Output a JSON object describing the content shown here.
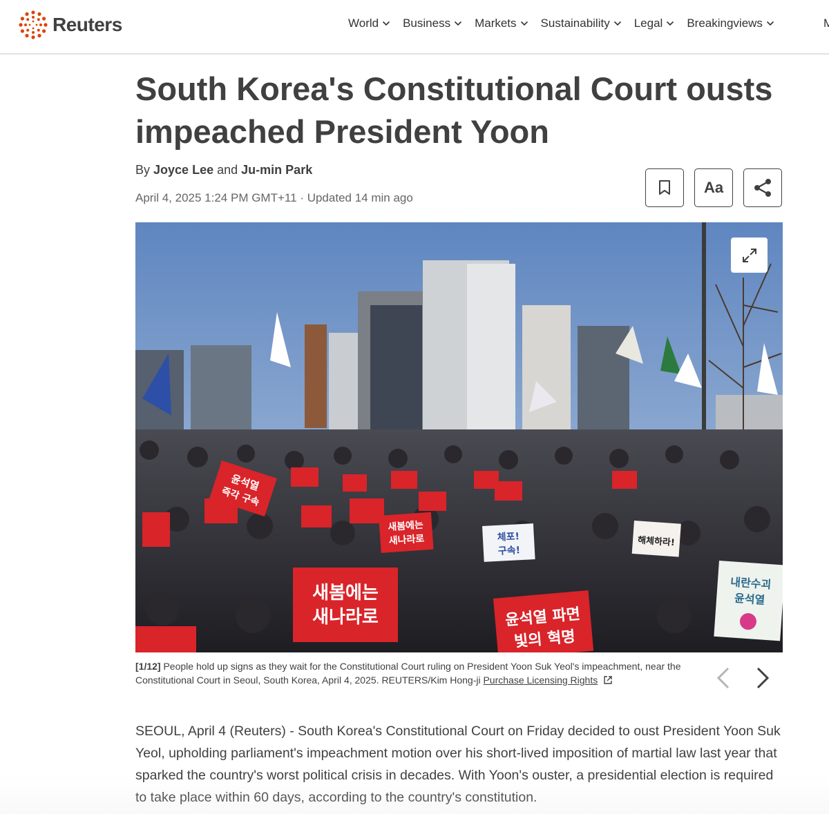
{
  "header": {
    "logo_text": "Reuters",
    "brand_color": "#dc4405",
    "nav": [
      {
        "label": "World"
      },
      {
        "label": "Business"
      },
      {
        "label": "Markets"
      },
      {
        "label": "Sustainability"
      },
      {
        "label": "Legal"
      },
      {
        "label": "Breakingviews"
      }
    ],
    "nav_overflow_label": "M"
  },
  "article": {
    "headline": "South Korea's Constitutional Court ousts impeached President Yoon",
    "byline": {
      "prefix": "By",
      "author_1": "Joyce Lee",
      "joiner": "and",
      "author_2": "Ju-min Park"
    },
    "published": "April 4, 2025 1:24 PM GMT+11",
    "separator": "·",
    "updated": "Updated 14 min ago",
    "tools": {
      "bookmark_icon": "bookmark-icon",
      "text_size_label": "Aa",
      "share_icon": "share-icon"
    },
    "photo": {
      "expand_icon": "expand-icon",
      "caption_counter": "[1/12]",
      "caption_text": "People hold up signs as they wait for the Constitutional Court ruling on President Yoon Suk Yeol's impeachment, near the Constitutional Court in Seoul, South Korea, April 4, 2025. REUTERS/Kim Hong-ji",
      "license_label": "Purchase Licensing Rights",
      "sign_text_1": "새봄에는",
      "sign_text_2": "새나라로",
      "sign_text_3": "윤석열 파면",
      "sign_text_4": "빛의 혁명",
      "sign_text_5": "윤석열",
      "sign_text_6": "즉각 구속",
      "sign_text_7": "체포!",
      "sign_text_8": "구속!",
      "sign_text_9": "내란수괴",
      "sign_text_10": "해체하라!"
    },
    "body_paragraph": "SEOUL, April 4 (Reuters) - South Korea's Constitutional Court on Friday decided to oust President Yoon Suk Yeol, upholding parliament's impeachment motion over his short-lived imposition of martial law last year that sparked the country's worst political crisis in decades. With Yoon's ouster, a presidential election is required to take place within 60 days, according to the country's constitution."
  }
}
